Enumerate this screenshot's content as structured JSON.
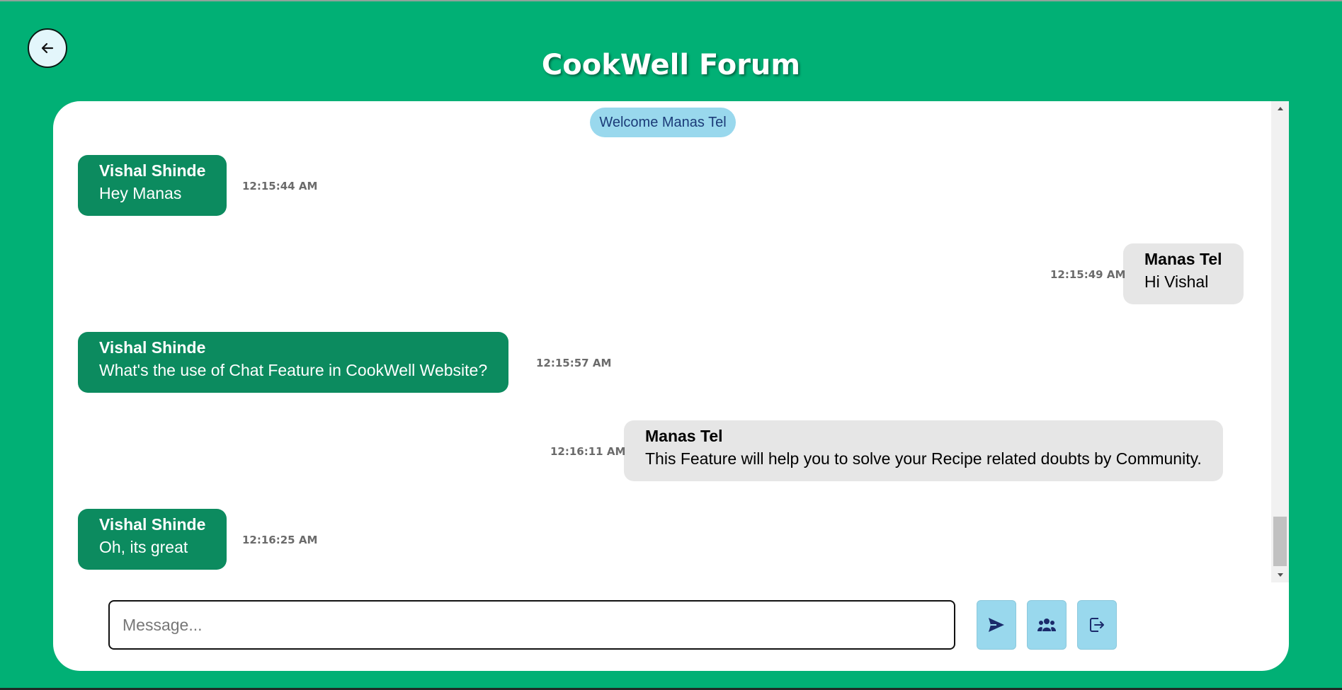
{
  "header": {
    "title": "CookWell Forum",
    "back_icon": "arrow-left-icon"
  },
  "chat": {
    "welcome": "Welcome Manas Tel",
    "messages": [
      {
        "direction": "incoming",
        "sender": "Vishal Shinde",
        "text": "Hey Manas",
        "time": "12:15:44 AM"
      },
      {
        "direction": "outgoing",
        "sender": "Manas Tel",
        "text": "Hi Vishal",
        "time": "12:15:49 AM"
      },
      {
        "direction": "incoming",
        "sender": "Vishal Shinde",
        "text": "What's the use of Chat Feature in CookWell Website?",
        "time": "12:15:57 AM"
      },
      {
        "direction": "outgoing",
        "sender": "Manas Tel",
        "text": "This Feature will help you to solve your Recipe related doubts by Community.",
        "time": "12:16:11 AM"
      },
      {
        "direction": "incoming",
        "sender": "Vishal Shinde",
        "text": "Oh, its great",
        "time": "12:16:25 AM"
      }
    ]
  },
  "composer": {
    "placeholder": "Message...",
    "value": "",
    "send_icon": "send-icon",
    "users_icon": "users-icon",
    "leave_icon": "leave-room-icon"
  },
  "colors": {
    "background": "#01b075",
    "incoming_bubble": "#0c8b5f",
    "outgoing_bubble": "#e6e6e6",
    "button": "#99d8ed",
    "icon": "#1b2a6b"
  }
}
